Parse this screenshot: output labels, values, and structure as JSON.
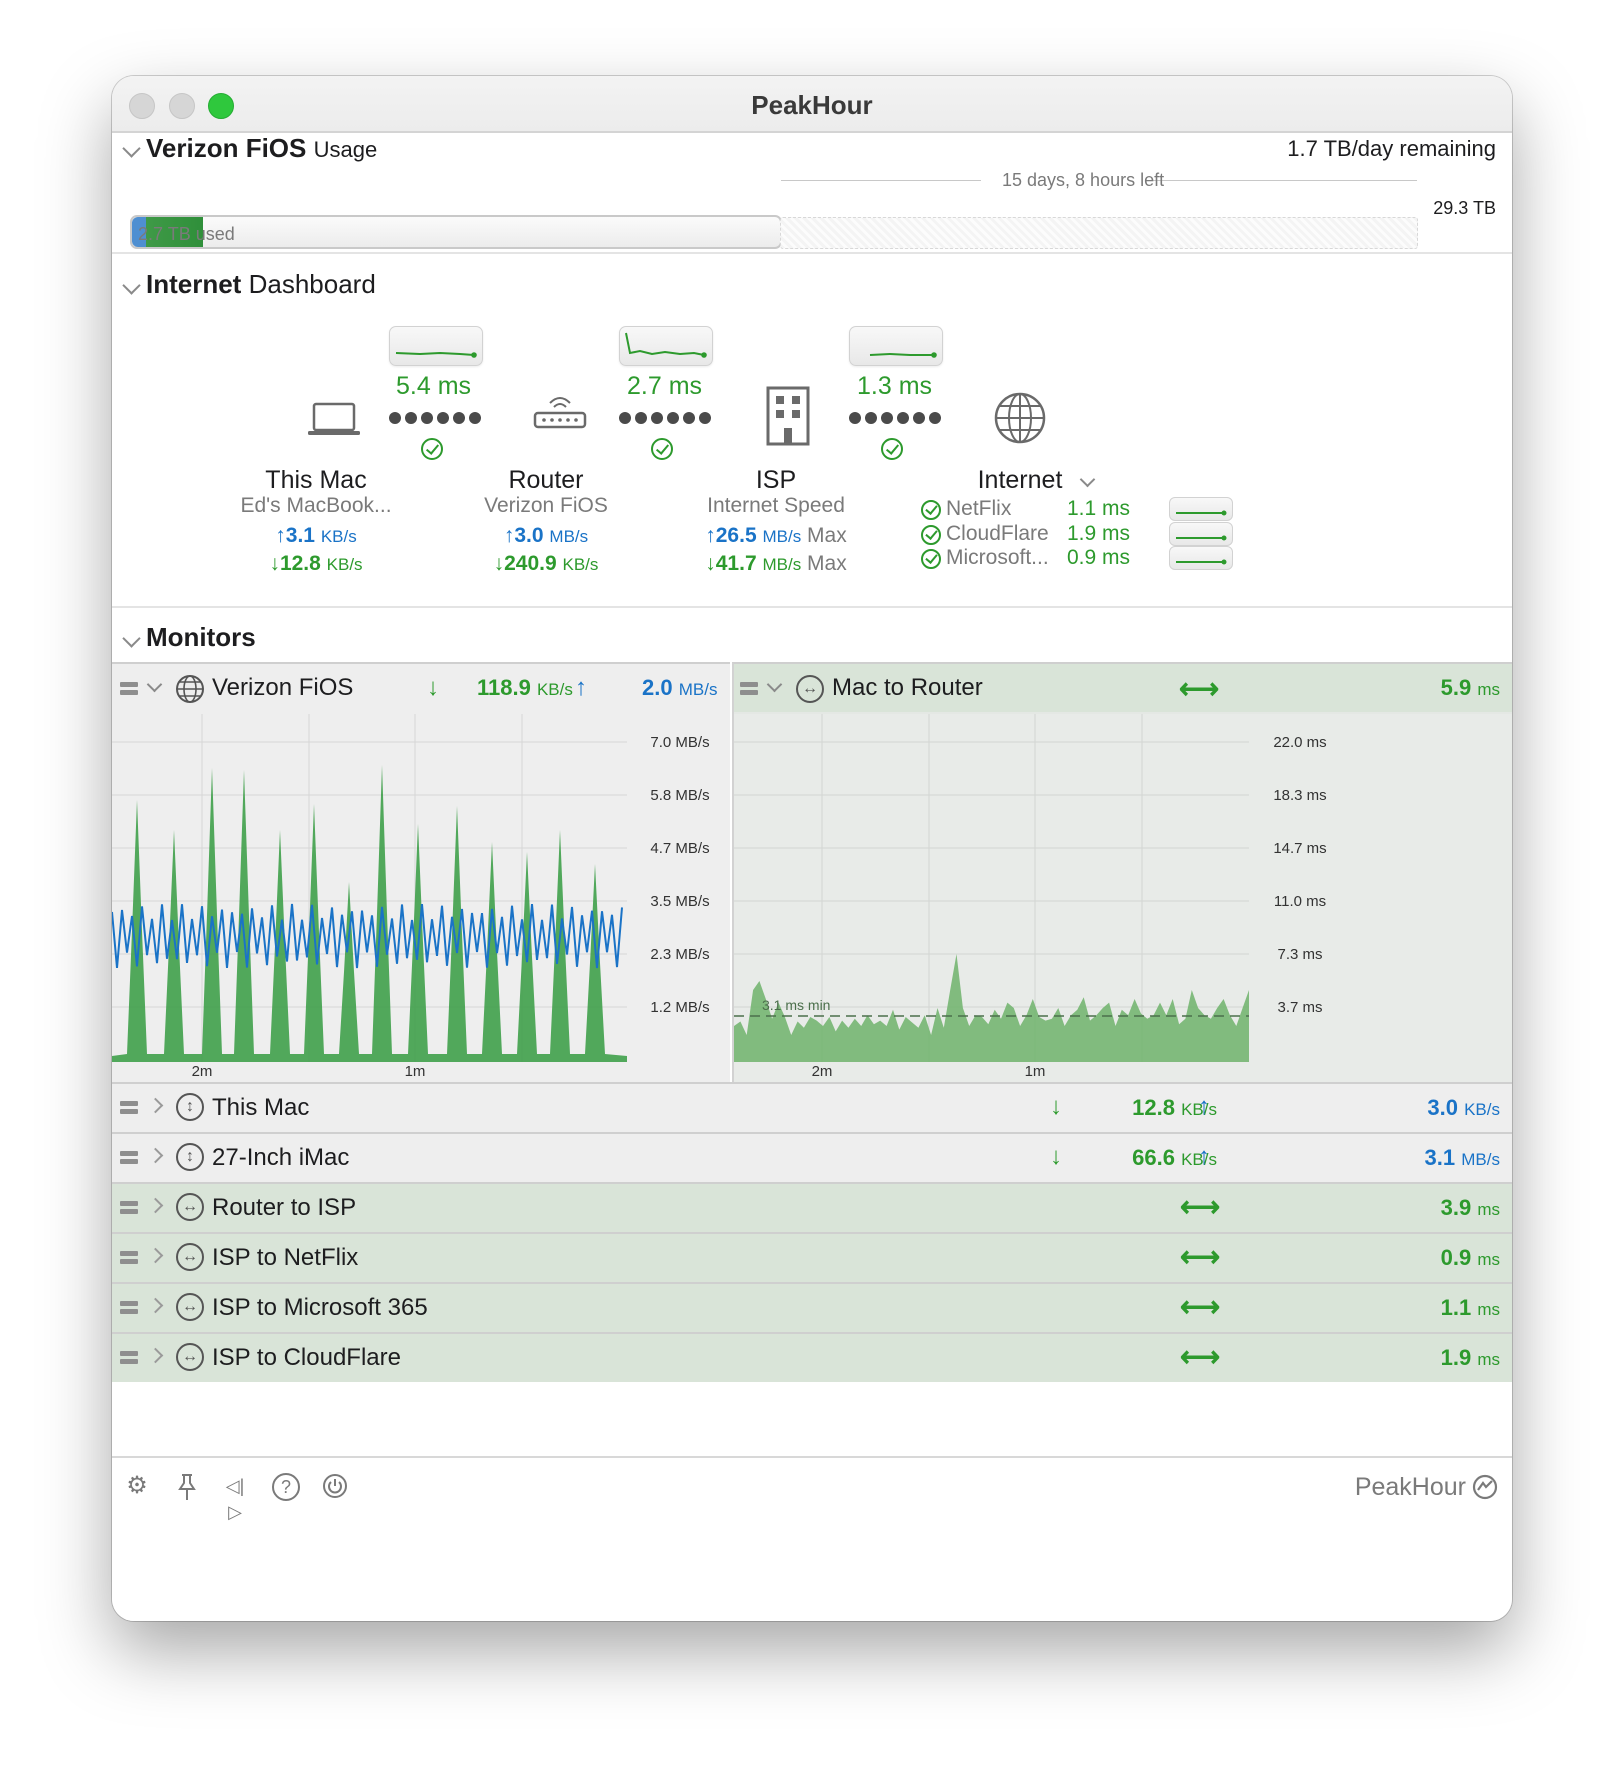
{
  "window": {
    "title": "PeakHour"
  },
  "usage": {
    "provider": "Verizon FiOS",
    "section": "Usage",
    "remaining": "1.7 TB/day remaining",
    "time_left": "15 days, 8 hours left",
    "used": "2.7 TB used",
    "total": "29.3 TB",
    "used_fraction": 0.092
  },
  "dashboard": {
    "title_bold": "Internet",
    "title_rest": "Dashboard",
    "nodes": [
      {
        "name": "This Mac",
        "sub": "Ed's MacBook...",
        "up": "3.1",
        "up_unit": "KB/s",
        "down": "12.8",
        "down_unit": "KB/s",
        "icon": "laptop-icon"
      },
      {
        "name": "Router",
        "sub": "Verizon FiOS",
        "up": "3.0",
        "up_unit": "MB/s",
        "down": "240.9",
        "down_unit": "KB/s",
        "icon": "router-icon"
      },
      {
        "name": "ISP",
        "sub": "Internet Speed",
        "up": "26.5",
        "up_unit": "MB/s",
        "up_suffix": "Max",
        "down": "41.7",
        "down_unit": "MB/s",
        "down_suffix": "Max",
        "icon": "building-icon"
      },
      {
        "name": "Internet",
        "icon": "globe-icon"
      }
    ],
    "links": [
      {
        "latency": "5.4 ms"
      },
      {
        "latency": "2.7 ms"
      },
      {
        "latency": "1.3 ms"
      }
    ],
    "targets": [
      {
        "name": "NetFlix",
        "latency": "1.1 ms"
      },
      {
        "name": "CloudFlare",
        "latency": "1.9 ms"
      },
      {
        "name": "Microsoft...",
        "latency": "0.9 ms"
      }
    ]
  },
  "monitors": {
    "title": "Monitors",
    "left": {
      "name": "Verizon FiOS",
      "down": "118.9",
      "down_unit": "KB/s",
      "up": "2.0",
      "up_unit": "MB/s",
      "y_ticks": [
        "7.0 MB/s",
        "5.8 MB/s",
        "4.7 MB/s",
        "3.5 MB/s",
        "2.3 MB/s",
        "1.2 MB/s"
      ],
      "x_ticks": [
        "2m",
        "1m"
      ]
    },
    "right": {
      "name": "Mac to Router",
      "value": "5.9",
      "unit": "ms",
      "y_ticks": [
        "22.0 ms",
        "18.3 ms",
        "14.7 ms",
        "11.0 ms",
        "7.3 ms",
        "3.7 ms"
      ],
      "x_ticks": [
        "2m",
        "1m"
      ],
      "min_label": "3.1 ms min"
    },
    "rows": [
      {
        "name": "This Mac",
        "type": "throughput",
        "down": "12.8",
        "down_unit": "KB/s",
        "up": "3.0",
        "up_unit": "KB/s"
      },
      {
        "name": "27-Inch iMac",
        "type": "throughput",
        "down": "66.6",
        "down_unit": "KB/s",
        "up": "3.1",
        "up_unit": "MB/s"
      },
      {
        "name": "Router to ISP",
        "type": "latency",
        "value": "3.9",
        "unit": "ms"
      },
      {
        "name": "ISP to NetFlix",
        "type": "latency",
        "value": "0.9",
        "unit": "ms"
      },
      {
        "name": "ISP to Microsoft 365",
        "type": "latency",
        "value": "1.1",
        "unit": "ms"
      },
      {
        "name": "ISP to CloudFlare",
        "type": "latency",
        "value": "1.9",
        "unit": "ms"
      }
    ]
  },
  "footer": {
    "brand": "PeakHour"
  },
  "colors": {
    "green": "#2d9a2d",
    "blue": "#1a73c7",
    "row_green": "#d9e4d8"
  }
}
